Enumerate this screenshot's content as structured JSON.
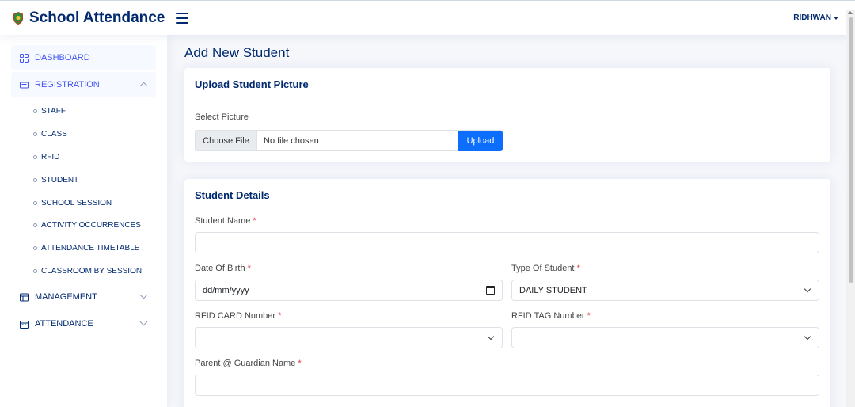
{
  "header": {
    "app_title": "School Attendance",
    "logo_icon": "school-crest-icon",
    "menu_icon": "hamburger-menu-icon",
    "user_name": "RIDHWAN"
  },
  "sidebar": {
    "items": [
      {
        "label": "DASHBOARD",
        "icon": "grid-icon"
      },
      {
        "label": "REGISTRATION",
        "icon": "id-card-icon",
        "expanded": true
      },
      {
        "label": "MANAGEMENT",
        "icon": "layout-icon",
        "expanded": false
      },
      {
        "label": "ATTENDANCE",
        "icon": "calendar-icon",
        "expanded": false
      }
    ],
    "registration_subitems": [
      "STAFF",
      "CLASS",
      "RFID",
      "STUDENT",
      "SCHOOL SESSION",
      "ACTIVITY OCCURRENCES",
      "ATTENDANCE TIMETABLE",
      "CLASSROOM BY SESSION"
    ]
  },
  "main": {
    "page_title": "Add New Student",
    "upload_card": {
      "title": "Upload Student Picture",
      "select_label": "Select Picture",
      "choose_file_label": "Choose File",
      "file_status": "No file chosen",
      "upload_label": "Upload"
    },
    "details_card": {
      "title": "Student Details",
      "student_name_label": "Student Name",
      "student_name_value": "",
      "dob_label": "Date Of Birth",
      "dob_placeholder": "dd/mm/yyyy",
      "type_label": "Type Of Student",
      "type_value": "DAILY STUDENT",
      "rfid_card_label": "RFID CARD Number",
      "rfid_card_value": "",
      "rfid_tag_label": "RFID TAG Number",
      "rfid_tag_value": "",
      "guardian_label": "Parent @ Guardian Name",
      "guardian_value": "",
      "required_mark": "*"
    }
  },
  "colors": {
    "primary_text": "#012970",
    "accent": "#4154f1",
    "upload_button": "#0d6efd",
    "required": "#dc3545",
    "page_background": "#f5f7fb"
  }
}
